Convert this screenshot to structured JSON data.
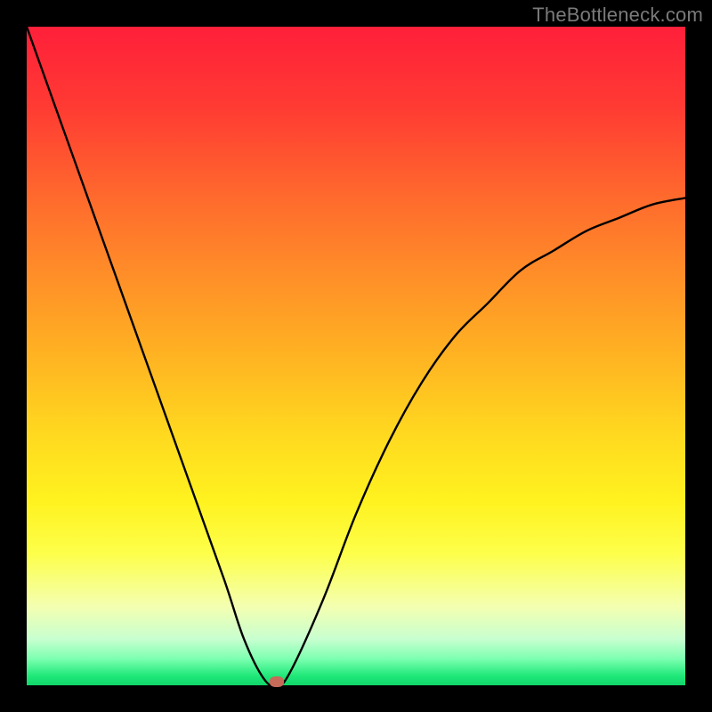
{
  "watermark": "TheBottleneck.com",
  "colors": {
    "frame": "#000000",
    "curve": "#000000",
    "marker": "#c66a5a"
  },
  "chart_data": {
    "type": "line",
    "title": "",
    "xlabel": "",
    "ylabel": "",
    "xlim": [
      0,
      100
    ],
    "ylim": [
      0,
      100
    ],
    "grid": false,
    "legend": false,
    "series": [
      {
        "name": "bottleneck-curve",
        "x": [
          0,
          5,
          10,
          15,
          20,
          25,
          30,
          33,
          36,
          38,
          40,
          45,
          50,
          55,
          60,
          65,
          70,
          75,
          80,
          85,
          90,
          95,
          100
        ],
        "y": [
          100,
          86,
          72,
          58,
          44,
          30,
          16,
          7,
          1,
          0,
          2,
          13,
          26,
          37,
          46,
          53,
          58,
          63,
          66,
          69,
          71,
          73,
          74
        ]
      }
    ],
    "annotations": [
      {
        "name": "min-marker",
        "x": 38,
        "y": 0.5
      }
    ]
  }
}
